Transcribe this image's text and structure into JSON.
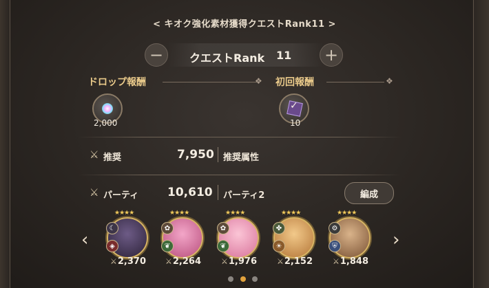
{
  "header": {
    "title": "< キオク強化素材獲得クエストRank11 >"
  },
  "rank": {
    "label": "クエストRank",
    "value": "11",
    "minus": "−",
    "plus": "+"
  },
  "drop": {
    "heading": "ドロップ報酬",
    "items": [
      {
        "icon": "rainbow-orb-icon",
        "count": "2,000"
      }
    ]
  },
  "first": {
    "heading": "初回報酬",
    "items": [
      {
        "icon": "purple-cube-icon",
        "count": "10"
      }
    ]
  },
  "recommend": {
    "label": "推奨",
    "value": "7,950",
    "attr_label": "推奨属性"
  },
  "party": {
    "label": "パーティ",
    "value": "10,610",
    "name": "パーティ2",
    "edit_label": "編成"
  },
  "characters": [
    {
      "power": "2,370",
      "stars": "★★★★",
      "palette": "dark",
      "type_icon": "moon-icon",
      "attr_icon": "fire-icon"
    },
    {
      "power": "2,264",
      "stars": "★★★★",
      "palette": "pink",
      "type_icon": "flower-icon",
      "attr_icon": "leaf-icon"
    },
    {
      "power": "1,976",
      "stars": "★★★★",
      "palette": "pink-light",
      "type_icon": "flower-icon",
      "attr_icon": "leaf-icon"
    },
    {
      "power": "2,152",
      "stars": "★★★★",
      "palette": "orange",
      "type_icon": "clover-icon",
      "attr_icon": "sun-icon"
    },
    {
      "power": "1,848",
      "stars": "★★★★",
      "palette": "brown",
      "type_icon": "gear-icon",
      "attr_icon": "shield-icon"
    }
  ],
  "pagination": {
    "active": 1,
    "count": 3
  },
  "colors": {
    "accent": "#e9c98a",
    "dot_active": "#e2a23d"
  }
}
